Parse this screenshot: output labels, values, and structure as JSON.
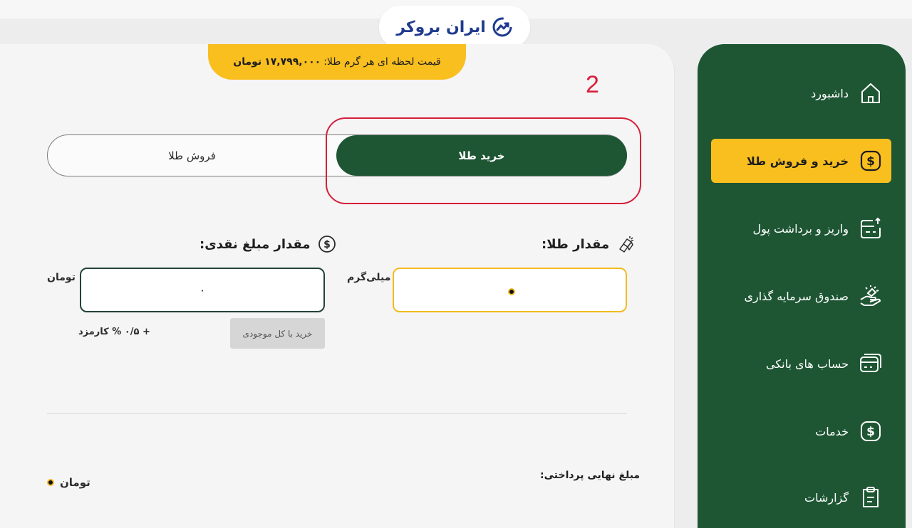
{
  "brand": {
    "logo_text": "ایران بروکر"
  },
  "price_banner": {
    "label": "قیمت لحظه ای هر گرم طلا:",
    "value": "۱۷,۷۹۹,۰۰۰",
    "unit": "تومان"
  },
  "annotation": {
    "step": "2",
    "highlight_color": "#d61f3a"
  },
  "tabs": {
    "buy": "خرید طلا",
    "sell": "فروش طلا",
    "active": "buy"
  },
  "gold_input": {
    "label": "مقدار طلا:",
    "unit": "میلی‌گرم",
    "value": ""
  },
  "cash_input": {
    "label": "مقدار مبلغ نقدی:",
    "unit": "تومان",
    "value": "۰"
  },
  "buy_all_button": "خرید با کل موجودی",
  "fee": "+ ۰/۵ % کارمزد",
  "final": {
    "label": "مبلغ نهایی پرداختی:",
    "unit": "تومان"
  },
  "sidebar": {
    "items": [
      {
        "label": "داشبورد",
        "icon": "home-icon",
        "active": false
      },
      {
        "label": "خرید و فروش طلا",
        "icon": "dollar-icon",
        "active": true
      },
      {
        "label": "واریز و برداشت پول",
        "icon": "wallet-transfer-icon",
        "active": false
      },
      {
        "label": "صندوق سرمایه گذاری",
        "icon": "investment-hand-icon",
        "active": false
      },
      {
        "label": "حساب های بانکی",
        "icon": "bank-card-icon",
        "active": false
      },
      {
        "label": "خدمات",
        "icon": "service-dollar-icon",
        "active": false
      },
      {
        "label": "گزارشات",
        "icon": "report-icon",
        "active": false
      }
    ]
  },
  "colors": {
    "primary": "#1e5634",
    "accent": "#f9bf1f",
    "background": "#f5f5f6"
  }
}
